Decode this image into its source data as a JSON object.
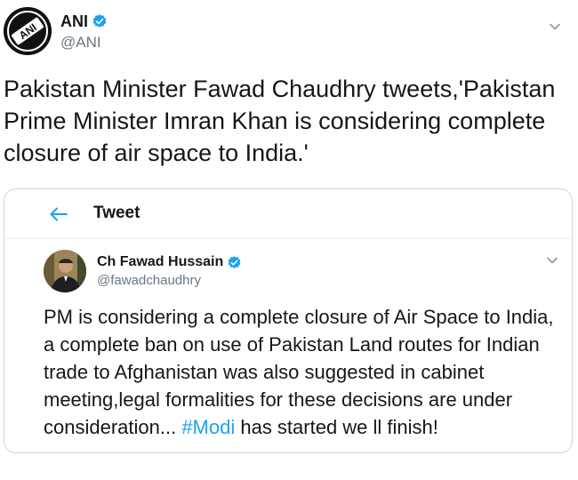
{
  "tweet": {
    "author_name": "ANI",
    "author_handle": "@ANI",
    "avatar_label": "ANI",
    "text": "Pakistan Minister Fawad Chaudhry tweets,'Pakistan Prime Minister Imran Khan is considering complete closure of air space to India.'"
  },
  "quote": {
    "topbar_title": "Tweet",
    "author_name": "Ch Fawad Hussain",
    "author_handle": "@fawadchaudhry",
    "text_before": "PM is considering a complete closure of Air Space to India, a complete ban on use of Pakistan Land routes for Indian trade to Afghanistan was also suggested in cabinet meeting,legal formalities for these decisions are under consideration... ",
    "hashtag": "#Modi",
    "text_after": " has started we ll finish!"
  },
  "colors": {
    "verified": "#1da1f2",
    "link": "#1da1f2",
    "handle": "#657786",
    "border": "#ccd6dd"
  },
  "icons": {
    "verified": "verified-badge-icon",
    "caret": "chevron-down-icon",
    "back": "back-arrow-icon"
  }
}
